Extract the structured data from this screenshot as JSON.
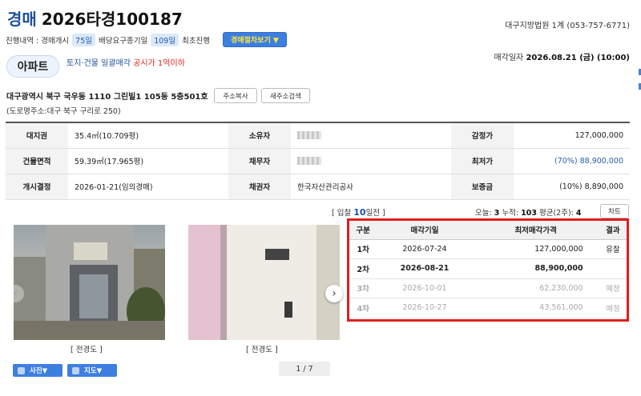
{
  "header": {
    "kind": "경매",
    "case_no": "2026타경100187",
    "court": "대구지방법원 1계 (053-757-6771)"
  },
  "progress": {
    "label": "진행내역 : 경매개시",
    "days1": "75일",
    "middle": "배당요구종기일",
    "days2": "109일",
    "last": "최초진행",
    "button": "경매절차보기 ▼"
  },
  "property": {
    "type": "아파트",
    "note": "토지·건물 일괄매각",
    "note_red": "공시가 1억이하",
    "sale_date_label": "매각일자",
    "sale_date": "2026.08.21 (금) (10:00)",
    "address": "대구광역시 북구 국우동 1110 그린빌1 105동 5층501호",
    "copy_btn": "주소복사",
    "search_btn": "새주소검색",
    "road_address": "(도로명주소:대구 북구 구리로 250)"
  },
  "info": {
    "rows": [
      {
        "h1": "대지권",
        "v1": "35.4㎡(10.709평)",
        "h2": "소유자",
        "h3": "감정가",
        "v3": "127,000,000"
      },
      {
        "h1": "건물면적",
        "v1": "59.39㎡(17.965평)",
        "h2": "채무자",
        "h3": "최저가",
        "v3": "(70%) 88,900,000"
      },
      {
        "h1": "개시결정",
        "v1": "2026-01-21(임의경매)",
        "h2": "채권자",
        "v2": "한국자산관리공사",
        "h3": "보증금",
        "v3": "(10%) 8,890,000"
      }
    ]
  },
  "bidding": {
    "prefix": "[ 입찰",
    "days": "10",
    "suffix": "일전 ]",
    "today_label": "오늘:",
    "today": "3",
    "total_label": "누적:",
    "total": "103",
    "avg_label": "평균(2주):",
    "avg": "4",
    "chart_btn": "차트"
  },
  "photos": {
    "caption1": "[ 전경도 ]",
    "caption2": "[ 전경도 ]",
    "photo_btn": "사진▼",
    "map_btn": "지도▼",
    "pager": "1 / 7"
  },
  "schedule": {
    "headers": [
      "구분",
      "매각기일",
      "최저매각가격",
      "결과"
    ],
    "rows": [
      {
        "round": "1차",
        "date": "2026-07-24",
        "price": "127,000,000",
        "result": "유찰"
      },
      {
        "round": "2차",
        "date": "2026-08-21",
        "price": "88,900,000",
        "result": ""
      },
      {
        "round": "3차",
        "date": "2026-10-01",
        "price": "62,230,000",
        "result": "예정"
      },
      {
        "round": "4차",
        "date": "2026-10-27",
        "price": "43,561,000",
        "result": "예정"
      }
    ]
  },
  "colors": {
    "brand": "#1e50a0",
    "highlight": "#e11d1d",
    "button": "#3d7fe0"
  }
}
